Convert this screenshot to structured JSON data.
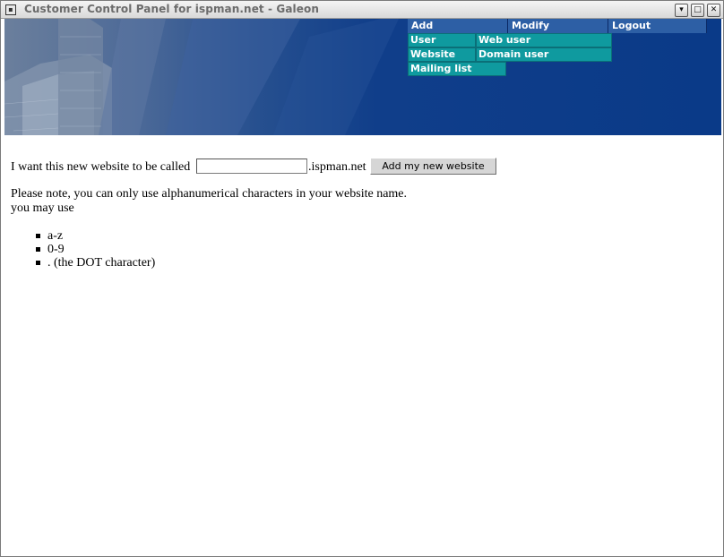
{
  "window": {
    "title": "Customer Control Panel for ispman.net - Galeon",
    "icon": "window-menu-icon",
    "controls": [
      "chevron-down-icon",
      "maximize-icon",
      "close-icon"
    ]
  },
  "nav": {
    "headers": [
      "Add",
      "Modify",
      "Logout"
    ],
    "add_items": [
      "User",
      "Website",
      "Mailing list"
    ],
    "modify_items": [
      "Web user",
      "Domain user"
    ],
    "colors": {
      "header_bg": "#2d5fa5",
      "item_bg": "#0f9a9f",
      "banner": "#0a3a88"
    }
  },
  "form": {
    "prompt": "I want this new website to be called",
    "domain_suffix": ".ispman.net",
    "input_value": "",
    "button_label": "Add my new website"
  },
  "notes": {
    "line1": "Please note, you can only use alphanumerical characters in your website name.",
    "line2": "you may use",
    "allowed": [
      "a-z",
      "0-9",
      ". (the DOT character)"
    ]
  }
}
